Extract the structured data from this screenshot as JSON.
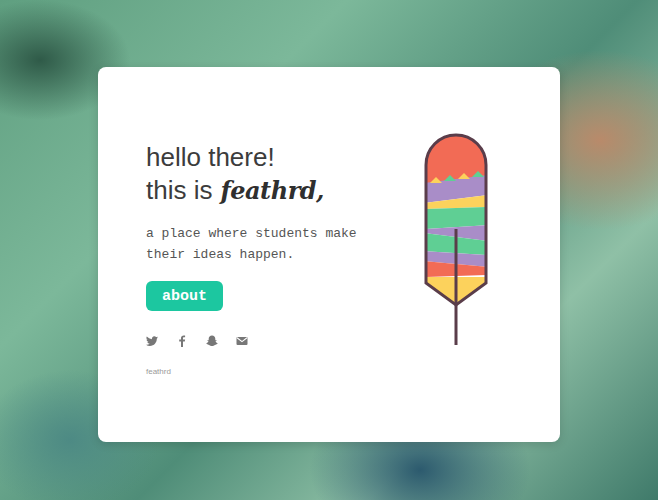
{
  "hero": {
    "greeting": "hello there!",
    "intro": "this is",
    "brand": "feathrd,"
  },
  "tagline": "a place where students make their ideas happen.",
  "button": "about",
  "footer": "feathrd"
}
